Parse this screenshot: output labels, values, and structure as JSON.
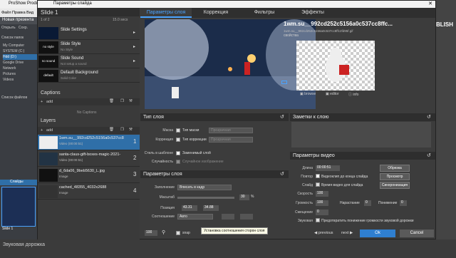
{
  "app": {
    "title": "ProShow Producer",
    "menu": "Файл  Правка  Вид",
    "project": "Новая презента",
    "open_label": "Открыть",
    "save_label": "Сохр.",
    "folders_label": "Список папок",
    "files_label": "Список файлов",
    "tree": [
      "My Computer",
      "SYSTEM (C:)",
      "Hdd (D:)",
      "Google Drive",
      "Network",
      "Pictures",
      "Videos"
    ],
    "right_label": "BLISH",
    "bottom_label": "Звуковая дорожка",
    "slides_tab": "Слайды",
    "slide1": "Slide 1"
  },
  "dialog": {
    "title": "Параметры слайда"
  },
  "left": {
    "slide_title": "Slide 1",
    "slide_count": "1 of 2",
    "slide_len": "15.0 secs",
    "rows": [
      {
        "thumb": "",
        "label": "Slide Settings",
        "sub": ""
      },
      {
        "thumb": "no style",
        "label": "Slide Style",
        "sub": "No Style"
      },
      {
        "thumb": "no sound",
        "label": "Slide Sound",
        "sub": "Not setup a sound"
      },
      {
        "thumb": "default",
        "label": "Default Background",
        "sub": "Solid Color"
      }
    ],
    "captions_title": "Captions",
    "add": "add",
    "no_captions": "No Captions",
    "layers_title": "Layers",
    "layers": [
      {
        "name": "1wm.su__992cd252c5156a0c537cc8",
        "sub": "Video (00:00:51)",
        "num": "1"
      },
      {
        "name": "santa-claus-gift-boxes-magic-2021-",
        "sub": "Video (00:00:51)",
        "num": "2"
      },
      {
        "name": "d_6da06_9beb5630_L.jpg",
        "sub": "Image",
        "num": "3"
      },
      {
        "name": "cached_48355_4032x2688",
        "sub": "Image",
        "num": "4"
      }
    ]
  },
  "tabs": [
    "Параметры слоя",
    "Коррекция",
    "Фильтры",
    "Эффекты"
  ],
  "file": {
    "name": "1wm.su__992cd252c5156a0c537cc8ffc...",
    "sub": "1wm.su__992cd252c5156a0c537cc8ffc2fd95f.gif",
    "props": "свойства",
    "browse": "browse",
    "editor": "editor",
    "info": "info"
  },
  "layer_type": {
    "title": "Тип слоя",
    "mask": "Маска",
    "mask_type": "Тип маски",
    "corr": "Коррекция",
    "corr_type": "Тип коррекции",
    "mask_sel": "Прозрачная",
    "corr_sel": "Прозрачная",
    "style": "Стиль в шаблоне",
    "replace": "Заменимый слой",
    "random": "Случайность",
    "rand_img": "Случайное изображение"
  },
  "notes": {
    "title": "Заметки к слою"
  },
  "layer_params": {
    "title": "Параметры слоя",
    "fill": "Заполнение",
    "fill_val": "Вписать в кадр",
    "scale": "Масштаб",
    "scale_val": "30",
    "position": "Позиция",
    "pos_x": "43.31",
    "pos_y": "34.88",
    "ratio": "Соотношение",
    "ratio_val": "Авто",
    "pct": "%"
  },
  "video": {
    "title": "Параметры видео",
    "length": "Длина",
    "length_val": "00:00:51",
    "trim": "Обрезка",
    "repeat": "Повтор",
    "repeat_lbl": "Видеоклип до конца слайда",
    "preview": "Просмотр",
    "slide": "Слайд",
    "slide_lbl": "Время видео для слайда",
    "sync": "Синхронизация",
    "speed": "Скорость",
    "speed_val": "100",
    "volume": "Громкость",
    "volume_val": "100",
    "fadein": "Нарастание",
    "fadein_val": "0",
    "fadeout": "Понижение",
    "fadeout_val": "0",
    "offset": "Смещение",
    "offset_val": "0",
    "sound": "Звуковая",
    "sound_lbl": "Предотвратить понижение громкости звуковой дорожки"
  },
  "footer": {
    "zoom": "100",
    "snap": "snap",
    "previous": "previous",
    "next": "next",
    "ok": "Ok",
    "cancel": "Cancel",
    "tooltip": "Установка соотношения сторон слоя"
  }
}
